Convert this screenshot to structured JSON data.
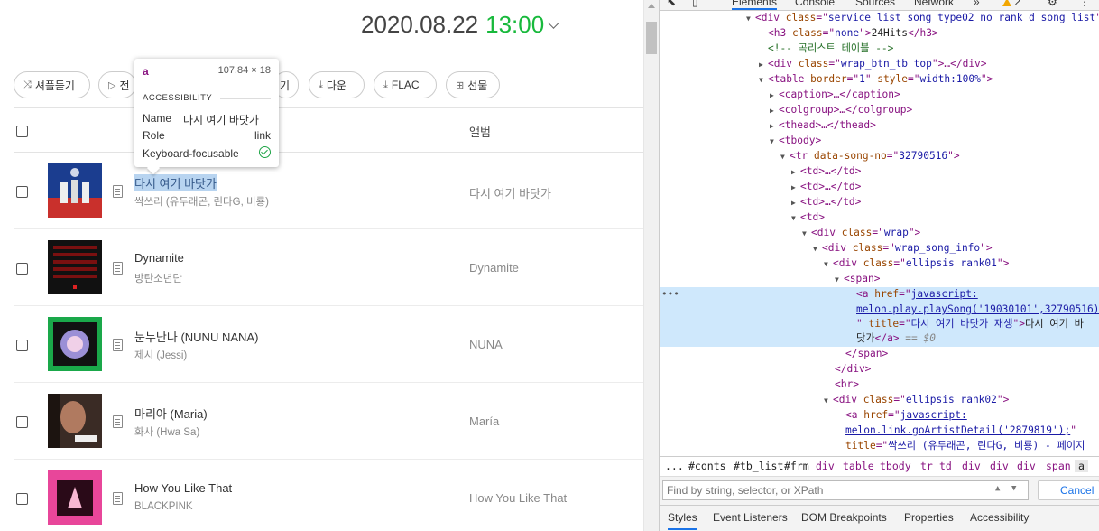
{
  "chart_header": {
    "date": "2020.08.22",
    "time": "13:00"
  },
  "toolbar": {
    "shuffle": "셔플듣기",
    "play": "전",
    "add_hidden": "기",
    "download": "다운",
    "flac": "FLAC",
    "gift": "선물"
  },
  "list_header": {
    "album": "앨범"
  },
  "songs": [
    {
      "title": "다시 여기 바닷가",
      "artist": "싹쓰리 (유두래곤, 린다G, 비룡)",
      "album": "다시 여기 바닷가"
    },
    {
      "title": "Dynamite",
      "artist": "방탄소년단",
      "album": "Dynamite"
    },
    {
      "title": "눈누난나 (NUNU NANA)",
      "artist": "제시 (Jessi)",
      "album": "NUNA"
    },
    {
      "title": "마리아 (Maria)",
      "artist": "화사 (Hwa Sa)",
      "album": "María"
    },
    {
      "title": "How You Like That",
      "artist": "BLACKPINK",
      "album": "How You Like That"
    }
  ],
  "tooltip": {
    "tag": "a",
    "size": "107.84 × 18",
    "section": "ACCESSIBILITY",
    "name_label": "Name",
    "name_value": "다시 여기 바닷가",
    "role_label": "Role",
    "role_value": "link",
    "focus_label": "Keyboard-focusable"
  },
  "devtools": {
    "tabs": {
      "elements": "Elements",
      "console": "Console",
      "sources": "Sources",
      "network": "Network",
      "more": "»",
      "warnings": "2",
      "kebab": "⋮",
      "gear": "⚙"
    },
    "dom": {
      "l1_class": "service_list_song type02 no_rank d_song_list",
      "l2_h3_class": "none",
      "l2_h3_text": "24Hits",
      "l3_comment": "<!-- 곡리스트 테이블 -->",
      "l4_class": "wrap_btn_tb top",
      "l5_border": "1",
      "l5_style": "width:100%",
      "l6": "caption",
      "l7": "colgroup",
      "l8": "thead",
      "l9": "tbody",
      "l10_attr": "data-song-no",
      "l10_val": "32790516",
      "l11": "td",
      "l15_class": "wrap",
      "l16_class": "wrap_song_info",
      "l17_class": "ellipsis rank01",
      "l18": "span",
      "a_href_1": "javascript:",
      "a_href_2": "melon.play.playSong('19030101',32790516);",
      "a_title": "다시 여기 바닷가 재생",
      "a_text_1": "다시 여기 바",
      "a_text_2": "닷가",
      "a_eq": "== $0",
      "l22_class": "ellipsis rank02",
      "b_href_1": "javascript:",
      "b_href_2": "melon.link.goArtistDetail('2879819');",
      "b_title": "싹쓰리 (유두래곤, 린다G, 비룡) - 페이지"
    },
    "breadcrumbs": [
      "...",
      "#conts",
      "#tb_list",
      "#frm",
      "div",
      "table",
      "tbody",
      "tr",
      "td",
      "div",
      "div",
      "div",
      "span",
      "a"
    ],
    "filter_placeholder": "Find by string, selector, or XPath",
    "cancel": "Cancel",
    "bottom_tabs": [
      "Styles",
      "Event Listeners",
      "DOM Breakpoints",
      "Properties",
      "Accessibility"
    ]
  },
  "colors": {
    "time": "#18b93c",
    "highlight": "#b8d4f0",
    "devtools_selected": "#cfe8fc"
  }
}
